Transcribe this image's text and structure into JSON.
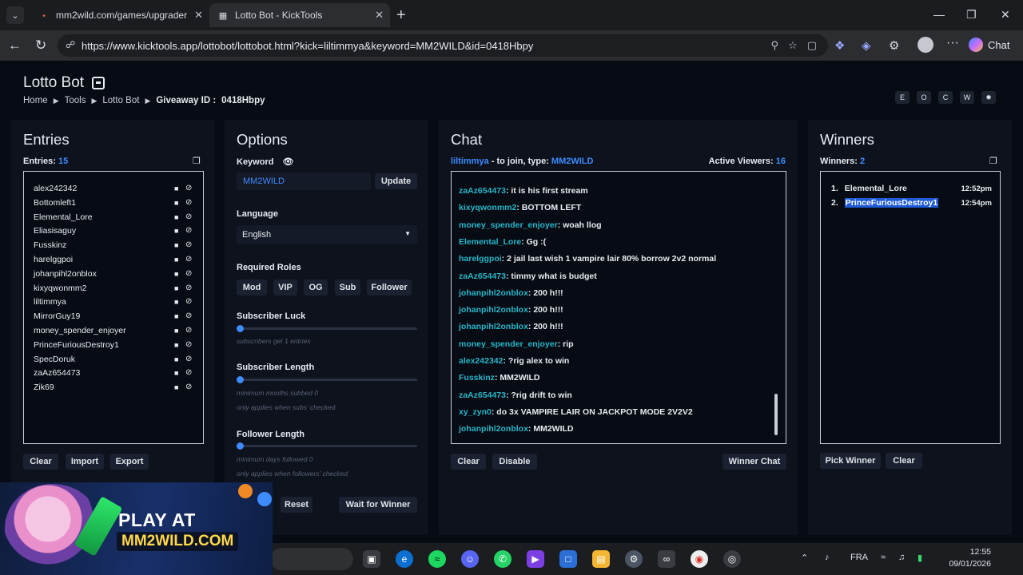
{
  "browser": {
    "tabs": [
      {
        "title": "mm2wild.com/games/upgrader",
        "active": false
      },
      {
        "title": "Lotto Bot - KickTools",
        "active": true
      }
    ],
    "url": "https://www.kicktools.app/lottobot/lottobot.html?kick=liltimmya&keyword=MM2WILD&id=0418Hbpy",
    "chat_button": "Chat"
  },
  "header": {
    "title": "Lotto Bot",
    "breadcrumbs": [
      "Home",
      "Tools",
      "Lotto Bot"
    ],
    "giveaway_label": "Giveaway ID :",
    "giveaway_id": "0418Hbpy",
    "theme_buttons": [
      "E",
      "O",
      "C",
      "W",
      "✹"
    ]
  },
  "entries": {
    "title": "Entries",
    "count_label": "Entries:",
    "count": "15",
    "list": [
      "alex242342",
      "Bottomleft1",
      "Elemental_Lore",
      "Eliasisaguy",
      "Fusskinz",
      "harelggpoi",
      "johanpihl2onblox",
      "kixyqwonmm2",
      "liltimmya",
      "MirrorGuy19",
      "money_spender_enjoyer",
      "PrinceFuriousDestroy1",
      "SpecDoruk",
      "zaAz654473",
      "Zik69"
    ],
    "buttons": {
      "clear": "Clear",
      "import": "Import",
      "export": "Export"
    }
  },
  "options": {
    "title": "Options",
    "keyword_label": "Keyword",
    "keyword_value": "MM2WILD",
    "update": "Update",
    "language_label": "Language",
    "language_value": "English",
    "roles_label": "Required Roles",
    "roles": [
      "Mod",
      "VIP",
      "OG",
      "Sub",
      "Follower"
    ],
    "sub_luck_label": "Subscriber Luck",
    "sub_luck_hint": "subscribers get 1 entries",
    "sub_luck_value": 1,
    "sub_length_label": "Subscriber Length",
    "sub_length_hint": "minimum months subbed 0",
    "sub_length_hint2": "only applies when subs' checked",
    "sub_length_value": 0,
    "follow_length_label": "Follower Length",
    "follow_length_hint": "minimum days followed 0",
    "follow_length_hint2": "only applies when followers' checked",
    "follow_length_value": 0,
    "reset": "Reset",
    "wait": "Wait for Winner"
  },
  "chat": {
    "title": "Chat",
    "channel": "liltimmya",
    "join_text": "- to join, type:",
    "keyword": "MM2WILD",
    "viewers_label": "Active Viewers:",
    "viewers": "16",
    "messages": [
      {
        "user": "zaAz654473",
        "text": "it is his first stream"
      },
      {
        "user": "kixyqwonmm2",
        "text": "BOTTOM LEFT"
      },
      {
        "user": "money_spender_enjoyer",
        "text": "woah llog"
      },
      {
        "user": "Elemental_Lore",
        "text": "Gg :("
      },
      {
        "user": "harelggpoi",
        "text": "2 jail last wish 1 vampire lair 80% borrow 2v2 normal"
      },
      {
        "user": "zaAz654473",
        "text": "timmy what is budget"
      },
      {
        "user": "johanpihl2onblox",
        "text": "200 h!!!"
      },
      {
        "user": "johanpihl2onblox",
        "text": "200 h!!!"
      },
      {
        "user": "johanpihl2onblox",
        "text": "200 h!!!"
      },
      {
        "user": "money_spender_enjoyer",
        "text": "rip"
      },
      {
        "user": "alex242342",
        "text": "?rig alex to win"
      },
      {
        "user": "Fusskinz",
        "text": "MM2WILD"
      },
      {
        "user": "zaAz654473",
        "text": "?rig drift to win"
      },
      {
        "user": "xy_zyn0",
        "text": "do 3x VAMPIRE LAIR ON JACKPOT MODE 2V2V2"
      },
      {
        "user": "johanpihl2onblox",
        "text": "MM2WILD"
      }
    ],
    "buttons": {
      "clear": "Clear",
      "disable": "Disable",
      "winner_chat": "Winner Chat"
    }
  },
  "winners": {
    "title": "Winners",
    "count_label": "Winners:",
    "count": "2",
    "list": [
      {
        "rank": "1.",
        "name": "Elemental_Lore",
        "time": "12:52pm"
      },
      {
        "rank": "2.",
        "name": "PrinceFuriousDestroy1",
        "time": "12:54pm"
      }
    ],
    "buttons": {
      "pick": "Pick Winner",
      "clear": "Clear"
    }
  },
  "ad": {
    "line1": "PLAY AT",
    "line2": "MM2WILD.COM"
  },
  "taskbar": {
    "lang": "FRA",
    "time": "12:55",
    "date": "09/01/2026"
  }
}
